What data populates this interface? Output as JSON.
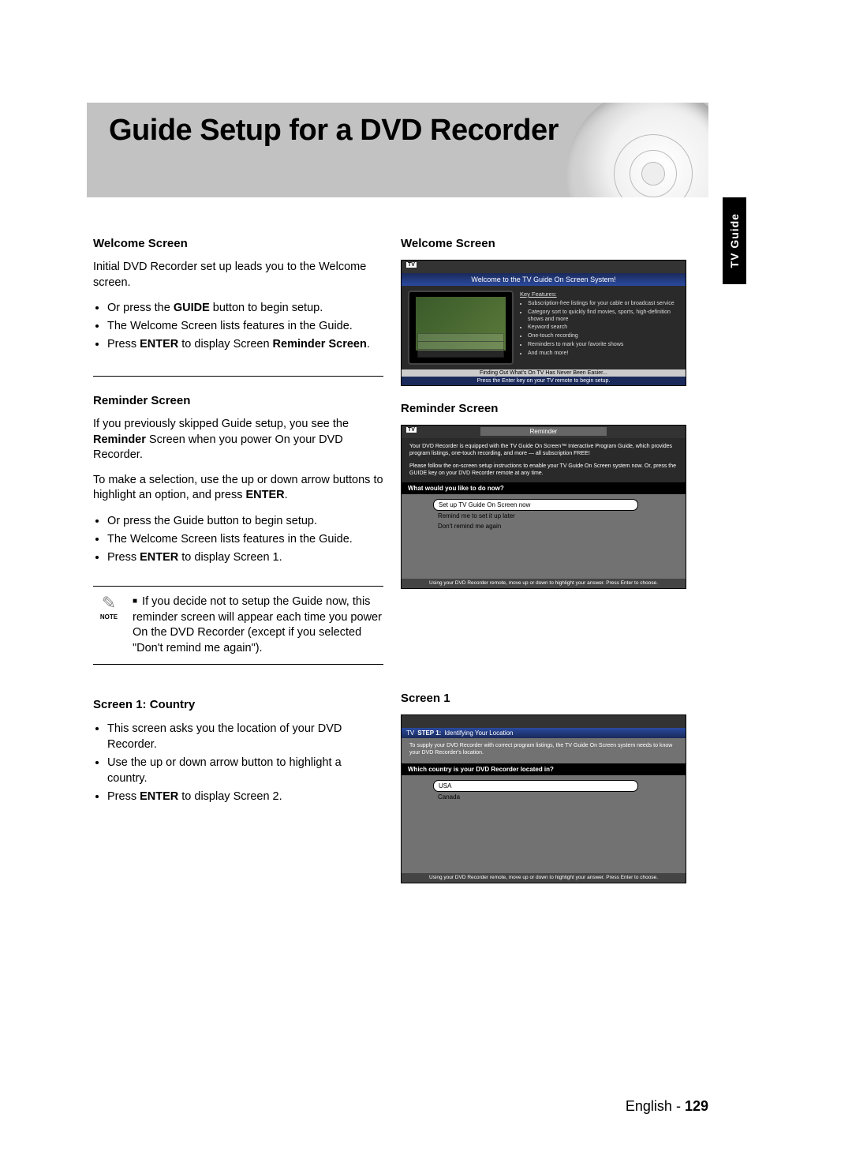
{
  "banner": {
    "title": "Guide Setup for a DVD Recorder"
  },
  "tab": {
    "label": "TV Guide"
  },
  "left": {
    "welcome": {
      "heading": "Welcome Screen",
      "intro": "Initial DVD Recorder set up leads you to the Welcome screen.",
      "b1_a": "Or press the ",
      "b1_b": "GUIDE",
      "b1_c": " button to begin setup.",
      "b2": "The Welcome Screen lists features in the Guide.",
      "b3_a": "Press ",
      "b3_b": "ENTER",
      "b3_c": " to display Screen ",
      "b3_d": "Reminder Screen",
      "b3_e": "."
    },
    "reminder": {
      "heading": "Reminder Screen",
      "p1_a": "If you previously skipped Guide setup, you see the ",
      "p1_b": "Reminder",
      "p1_c": " Screen when you power On your DVD Recorder.",
      "p2_a": "To make a selection, use the up or down arrow buttons to highlight an option, and press ",
      "p2_b": "ENTER",
      "p2_c": ".",
      "b1": "Or press the Guide button to begin setup.",
      "b2": "The Welcome Screen lists features in the Guide.",
      "b3_a": "Press ",
      "b3_b": "ENTER",
      "b3_c": " to display Screen 1."
    },
    "note": {
      "label": "NOTE",
      "text": "If you decide not to setup the Guide now, this reminder screen will appear each time you power On the DVD Recorder (except if you selected \"Don't remind me again\")."
    },
    "screen1": {
      "heading": "Screen 1: Country",
      "b1": "This screen asks you the location of your DVD Recorder.",
      "b2": "Use the up or down arrow button to highlight a country.",
      "b3_a": "Press ",
      "b3_b": "ENTER",
      "b3_c": " to display Screen 2."
    }
  },
  "right": {
    "welcome": {
      "heading": "Welcome Screen",
      "banner": "Welcome to the TV Guide On Screen System!",
      "kf_title": "Key Features:",
      "kf": [
        "Subscription-free listings for your cable or broadcast service",
        "Category sort to quickly find movies, sports, high-definition shows and more",
        "Keyword search",
        "One-touch recording",
        "Reminders to mark your favorite shows",
        "And much more!"
      ],
      "foot1": "Finding Out What's On TV Has Never Been Easier...",
      "foot2": "Press the Enter key on your TV remote to begin setup."
    },
    "reminder": {
      "heading": "Reminder Screen",
      "title": "Reminder",
      "p1": "Your DVD Recorder is equipped with the TV Guide On Screen™ Interactive Program Guide, which provides program listings, one-touch recording, and more — all subscription FREE!",
      "p2": "Please follow the on-screen setup instructions to enable your TV Guide On Screen system now. Or, press the GUIDE key on your DVD Recorder remote at any time.",
      "question": "What would you like to do now?",
      "opt1": "Set up TV Guide On Screen now",
      "opt2": "Remind me to set it up later",
      "opt3": "Don't remind me again",
      "foot": "Using your DVD Recorder remote, move up or down to highlight your answer.  Press Enter to choose."
    },
    "screen1": {
      "heading": "Screen 1",
      "step_label": "STEP 1:",
      "step_title": "Identifying Your Location",
      "intro": "To supply your DVD Recorder with correct program listings, the TV Guide On Screen system needs to know your DVD Recorder's location.",
      "question": "Which country is your DVD Recorder located in?",
      "opt1": "USA",
      "opt2": "Canada",
      "foot": "Using your DVD Recorder remote, move up or down to highlight your answer.  Press Enter to choose."
    }
  },
  "footer": {
    "lang": "English - ",
    "page": "129"
  }
}
